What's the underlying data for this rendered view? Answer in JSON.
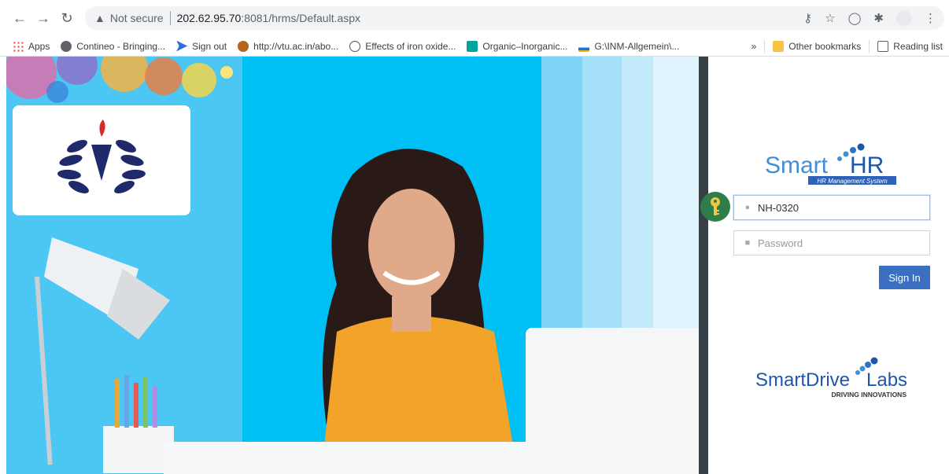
{
  "browser": {
    "not_secure_label": "Not secure",
    "url_host": "202.62.95.70",
    "url_rest": ":8081/hrms/Default.aspx"
  },
  "bookmarks": {
    "items": [
      {
        "label": "Apps",
        "icon": "apps-grid-icon"
      },
      {
        "label": "Contineo - Bringing...",
        "icon": "globe-icon"
      },
      {
        "label": "Sign out",
        "icon": "signout-arrow-icon"
      },
      {
        "label": "http://vtu.ac.in/abo...",
        "icon": "site-favicon-icon"
      },
      {
        "label": "Effects of iron oxide...",
        "icon": "science-favicon-icon"
      },
      {
        "label": "Organic–Inorganic...",
        "icon": "researchgate-icon"
      },
      {
        "label": "G:\\INM-Allgemein\\...",
        "icon": "file-icon"
      }
    ],
    "overflow": "»",
    "other_bookmarks": "Other bookmarks",
    "reading_list": "Reading list"
  },
  "login": {
    "brand_main": "Smart",
    "brand_hr": "HR",
    "brand_tagline": "HR Management System",
    "username_value": "NH-0320",
    "password_placeholder": "Password",
    "signin_label": "Sign In",
    "vendor_name": "SmartDrive",
    "vendor_suffix": "Labs",
    "vendor_tagline": "DRIVING INNOVATIONS"
  },
  "colors": {
    "brand_blue": "#3a6fc2",
    "hero_sky": "#00bff5",
    "logo_navy": "#1f2a6b",
    "key_green": "#2f7d48"
  }
}
